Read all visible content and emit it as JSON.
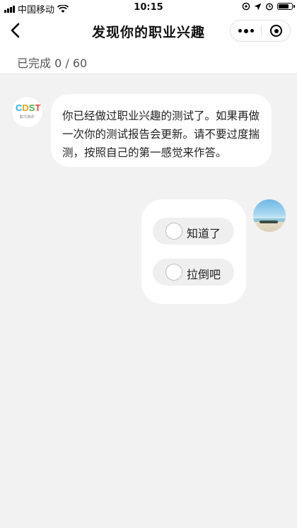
{
  "status_bar": {
    "carrier": "中国移动",
    "time": "10:15",
    "battery_level": 0.85
  },
  "navbar": {
    "title": "发现你的职业兴趣",
    "icons": [
      "back-icon",
      "more-icon",
      "close-icon"
    ]
  },
  "progress": {
    "text": "已完成 0 / 60",
    "completed": 0,
    "total": 60
  },
  "chat": {
    "bot": {
      "logo_text": "CDST",
      "logo_sub": "职力测评",
      "message": "你已经做过职业兴趣的测试了。如果再做一次你的测试报告会更新。请不要过度揣测，按照自己的第一感觉来作答。"
    },
    "user": {
      "options": [
        {
          "label": "知道了"
        },
        {
          "label": "拉倒吧"
        }
      ]
    }
  },
  "colors": {
    "background": "#f2f2f2",
    "card": "#ffffff",
    "option_bg": "#efefef"
  }
}
